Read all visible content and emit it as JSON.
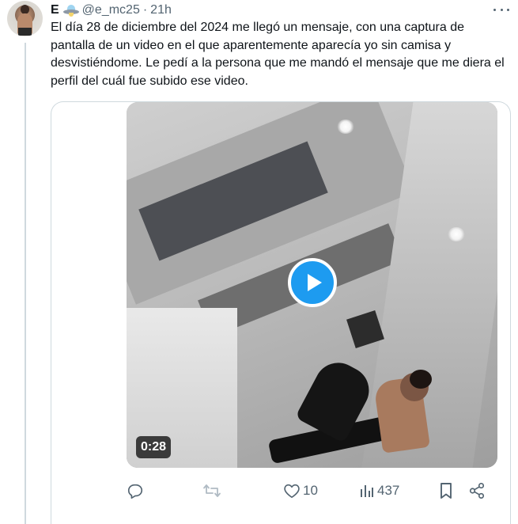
{
  "post": {
    "author_name": "E",
    "handle": "@e_mc25",
    "separator": "·",
    "time": "21h",
    "text": "El día 28 de diciembre del 2024 me llegó un mensaje, con una captura de pantalla de un video en el que aparentemente aparecía yo sin camisa y desvistiéndome. Le pedí a la persona que me mandó el mensaje que me diera el perfil del cuál fue subido ese video.",
    "badge_icon": "ufo-icon"
  },
  "media": {
    "duration": "0:28",
    "play_icon": "play-icon"
  },
  "actions": {
    "reply_count": "",
    "retweet_count": "",
    "like_count": "10",
    "views_count": "437"
  },
  "colors": {
    "accent": "#1d9bf0",
    "secondary_text": "#536471",
    "border": "#cfd9de"
  }
}
